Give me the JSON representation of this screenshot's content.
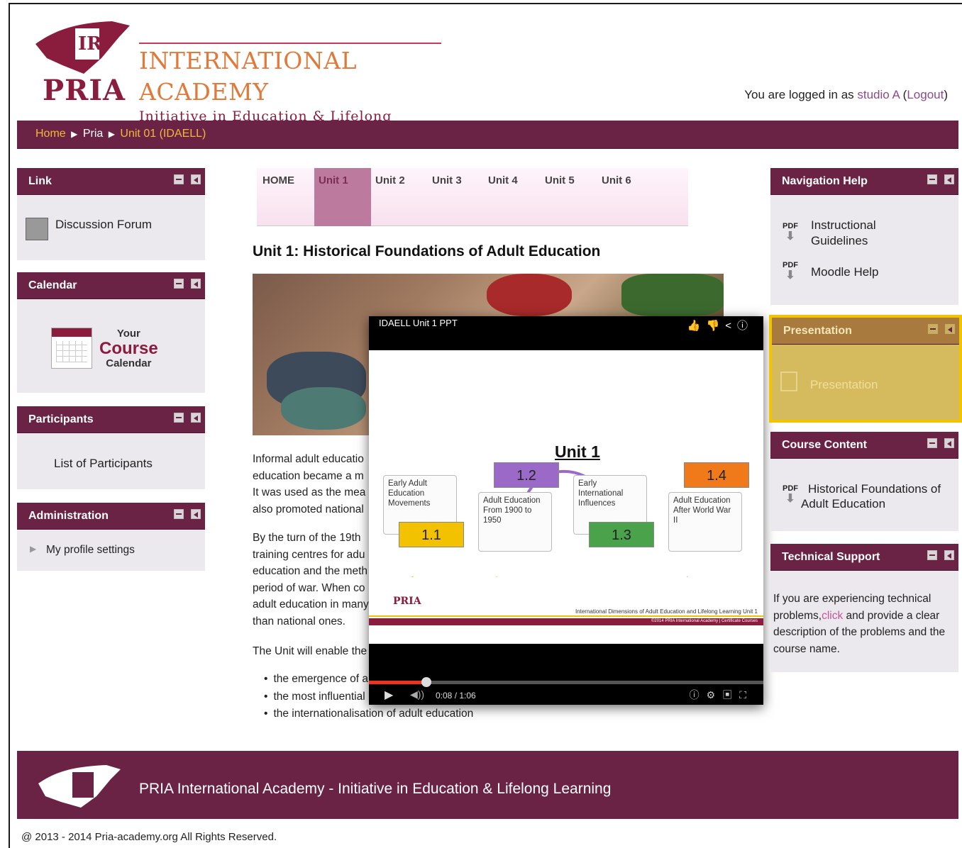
{
  "header": {
    "logo_text": "PRIA",
    "academy_title": "INTERNATIONAL ACADEMY",
    "academy_subtitle": "Initiative in Education & Lifelong Learning",
    "login_prefix": "You are logged in as ",
    "login_user": "studio A",
    "login_paren_open": " (",
    "login_logout": "Logout",
    "login_paren_close": ")"
  },
  "breadcrumb": {
    "home": "Home",
    "pria": "Pria",
    "unit": "Unit 01 (IDAELL)",
    "separator": "▶"
  },
  "left_blocks": {
    "link": {
      "title": "Link",
      "item": "Discussion Forum"
    },
    "calendar": {
      "title": "Calendar",
      "line1": "Your",
      "line2": "Course",
      "line3": "Calendar"
    },
    "participants": {
      "title": "Participants",
      "item": "List of Participants"
    },
    "administration": {
      "title": "Administration",
      "item": "My profile settings"
    }
  },
  "tabs": [
    "HOME",
    "Unit 1",
    "Unit 2",
    "Unit 3",
    "Unit 4",
    "Unit 5",
    "Unit 6"
  ],
  "active_tab": "Unit 1",
  "main": {
    "heading": "Unit 1: Historical Foundations of Adult Education",
    "para1": [
      "Informal adult educatio",
      "education became a m",
      "It was used as the mea",
      "also promoted national"
    ],
    "para2": [
      "By the turn of the 19th",
      "training centres for adu",
      "education and the meth",
      "period of war. When co",
      "adult education in many",
      "than national ones."
    ],
    "para3": "The Unit will enable the",
    "bullets": [
      "the emergence of a",
      "the most influential",
      "the internationalisation of adult education"
    ]
  },
  "video": {
    "title": "IDAELL Unit 1 PPT",
    "slide_title": "Unit 1",
    "cards": [
      {
        "text": "Early Adult Education Movements",
        "badge": "1.1",
        "color": "#f2c200"
      },
      {
        "text": "Adult Education From 1900 to 1950",
        "badge": "1.2",
        "color": "#9b6ac9"
      },
      {
        "text": "Early International Influences",
        "badge": "1.3",
        "color": "#4aa34a"
      },
      {
        "text": "Adult Education After World War II",
        "badge": "1.4",
        "color": "#f07a1a"
      }
    ],
    "slide_footer": "International Dimensions of Adult Education and Lifelong Learning Unit 1",
    "slide_footer_small": "©2014 PRIA International Academy | Certificate Courses",
    "time": "0:08 / 1:06",
    "progress": 0.12
  },
  "right_blocks": {
    "navigation_help": {
      "title": "Navigation Help",
      "item1": "Instructional Guidelines",
      "item2": "Moodle Help"
    },
    "presentation": {
      "title": "Presentation",
      "item": "Presentation"
    },
    "course_content": {
      "title": "Course Content",
      "item": "Historical Foundations of Adult Education"
    },
    "technical_support": {
      "title": "Technical Support",
      "text_before": "If you are experiencing technical problems,",
      "link": "click",
      "text_after": " and provide a clear description of the problems and the course name."
    },
    "pdf_label": "PDF"
  },
  "footer": {
    "text": "PRIA International Academy - Initiative in Education & Lifelong Learning",
    "copyright": "@ 2013 - 2014 Pria-academy.org All Rights Reserved."
  },
  "colors": {
    "brand": "#6a2344",
    "accent_link": "#f0b83a",
    "highlight": "#f2c400"
  }
}
